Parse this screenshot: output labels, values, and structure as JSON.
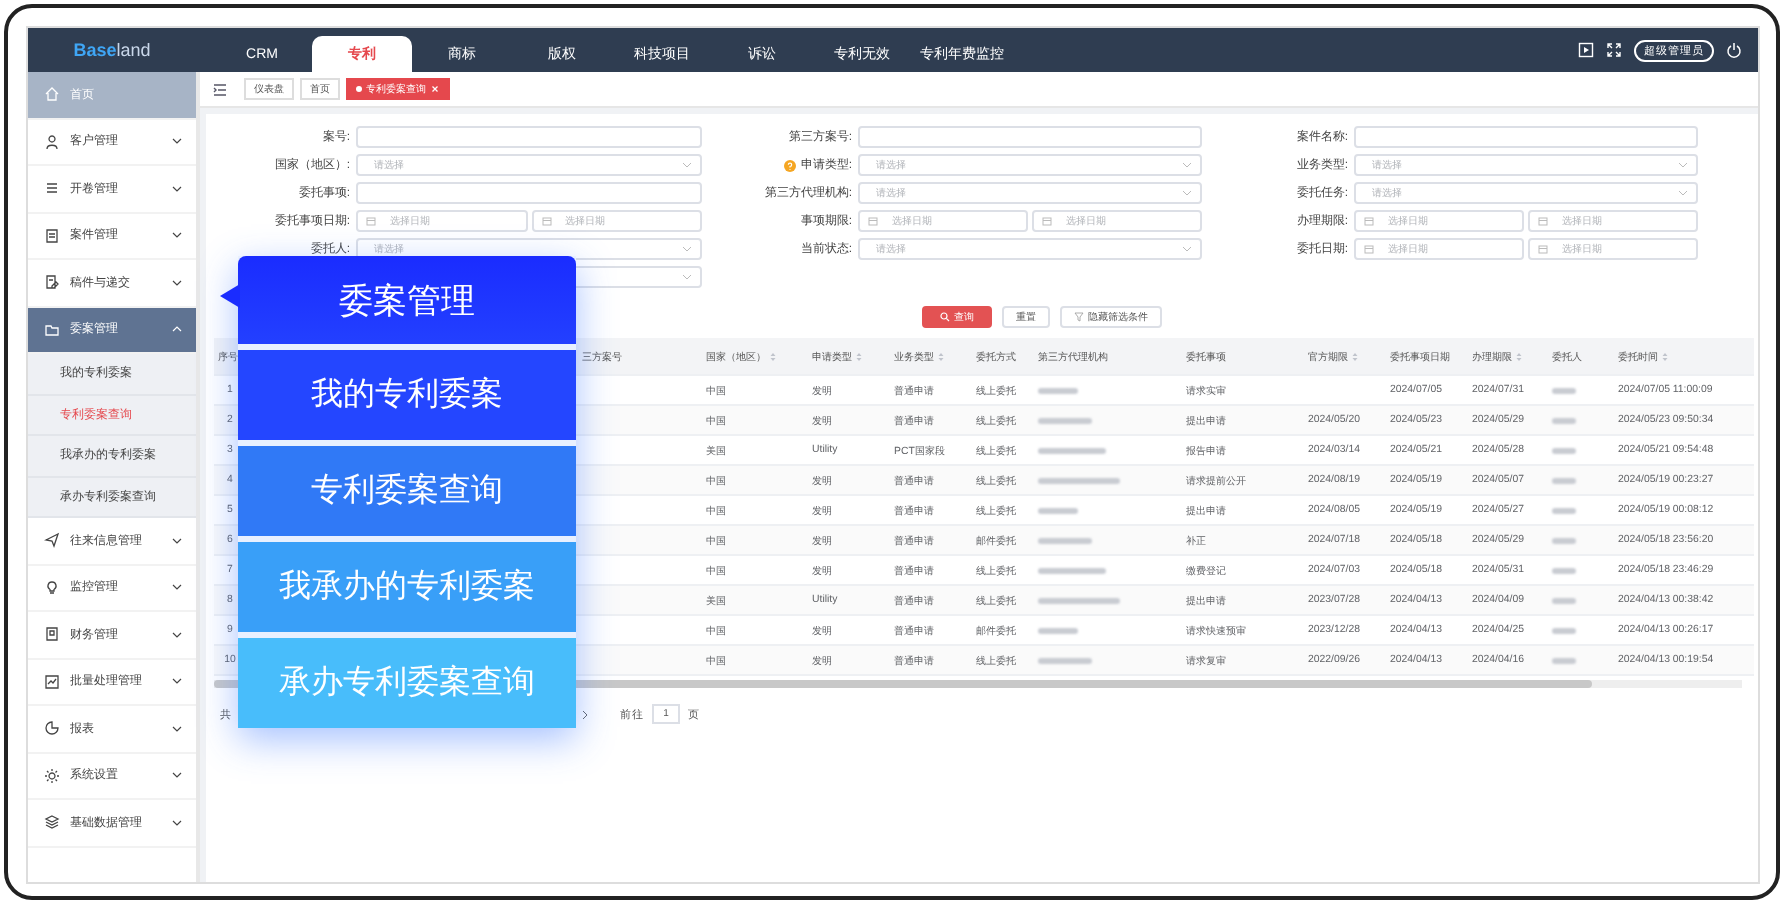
{
  "topbar": {
    "logo": {
      "part_1": "Base",
      "part_2": "land"
    },
    "tabs": [
      {
        "label": "CRM",
        "selected": false
      },
      {
        "label": "专利",
        "selected": true
      },
      {
        "label": "商标",
        "selected": false
      },
      {
        "label": "版权",
        "selected": false
      },
      {
        "label": "科技项目",
        "selected": false
      },
      {
        "label": "诉讼",
        "selected": false
      },
      {
        "label": "专利无效",
        "selected": false
      },
      {
        "label": "专利年费监控",
        "selected": false
      }
    ],
    "user": "超级管理员"
  },
  "tags_bar": {
    "tags": [
      {
        "label": "仪表盘",
        "selected": false,
        "closable": false
      },
      {
        "label": "首页",
        "selected": false,
        "closable": false
      },
      {
        "label": "专利委案查询",
        "selected": true,
        "closable": true
      }
    ]
  },
  "sidebar": {
    "items": [
      {
        "label": "首页",
        "selected": true
      },
      {
        "label": "客户管理",
        "selected": false,
        "expanded": false
      },
      {
        "label": "开卷管理",
        "selected": false,
        "expanded": false
      },
      {
        "label": "案件管理",
        "selected": false,
        "expanded": false
      },
      {
        "label": "稿件与递交",
        "selected": false,
        "expanded": false
      },
      {
        "label": "委案管理",
        "selected": false,
        "expanded": true,
        "children": [
          {
            "label": "我的专利委案",
            "selected": false
          },
          {
            "label": "专利委案查询",
            "selected": true
          },
          {
            "label": "我承办的专利委案",
            "selected": false
          },
          {
            "label": "承办专利委案查询",
            "selected": false
          }
        ]
      },
      {
        "label": "往来信息管理",
        "selected": false,
        "expanded": false
      },
      {
        "label": "监控管理",
        "selected": false,
        "expanded": false
      },
      {
        "label": "财务管理",
        "selected": false,
        "expanded": false
      },
      {
        "label": "批量处理管理",
        "selected": false,
        "expanded": false
      },
      {
        "label": "报表",
        "selected": false,
        "expanded": false
      },
      {
        "label": "系统设置",
        "selected": false,
        "expanded": false
      },
      {
        "label": "基础数据管理",
        "selected": false,
        "expanded": false
      }
    ]
  },
  "filters": [
    {
      "label": "案号:",
      "kind": "text"
    },
    {
      "label": "第三方案号:",
      "kind": "text"
    },
    {
      "label": "案件名称:",
      "kind": "text"
    },
    {
      "label": "国家（地区）:",
      "kind": "select",
      "placeholder": "请选择"
    },
    {
      "label": "申请类型:",
      "kind": "select",
      "placeholder": "请选择",
      "hint": true
    },
    {
      "label": "业务类型:",
      "kind": "select",
      "placeholder": "请选择"
    },
    {
      "label": "委托事项:",
      "kind": "text"
    },
    {
      "label": "第三方代理机构:",
      "kind": "select",
      "placeholder": "请选择"
    },
    {
      "label": "委托任务:",
      "kind": "select",
      "placeholder": "请选择"
    },
    {
      "label": "委托事项日期:",
      "kind": "date_range",
      "placeholders": [
        "选择日期",
        "选择日期"
      ]
    },
    {
      "label": "事项期限:",
      "kind": "date_range",
      "placeholders": [
        "选择日期",
        "选择日期"
      ]
    },
    {
      "label": "办理期限:",
      "kind": "date_range",
      "placeholders": [
        "选择日期",
        "选择日期"
      ]
    },
    {
      "label": "委托人:",
      "kind": "select",
      "placeholder": "请选择"
    },
    {
      "label": "当前状态:",
      "kind": "select",
      "placeholder": "请选择"
    },
    {
      "label": "委托日期:",
      "kind": "date_range",
      "placeholders": [
        "选择日期",
        "选择日期"
      ]
    },
    {
      "kind": "select"
    }
  ],
  "buttons": [
    {
      "label": "查询",
      "kind": "primary"
    },
    {
      "label": "重置",
      "kind": "default"
    },
    {
      "label": "隐藏筛选条件",
      "kind": "filter"
    }
  ],
  "table": {
    "columns": [
      {
        "label": "序号"
      },
      {
        "label": "三方案号"
      },
      {
        "label": "国家（地区）",
        "sortable": true
      },
      {
        "label": "申请类型",
        "sortable": true
      },
      {
        "label": "业务类型",
        "sortable": true
      },
      {
        "label": "委托方式"
      },
      {
        "label": "第三方代理机构",
        "blurred": true
      },
      {
        "label": "委托事项"
      },
      {
        "label": "官方期限",
        "sortable": true
      },
      {
        "label": "委托事项日期"
      },
      {
        "label": "办理期限",
        "sortable": true
      },
      {
        "label": "委托人",
        "blurred": true
      },
      {
        "label": "委托时间",
        "sortable": true
      }
    ],
    "rows": [
      {
        "cells": [
          "1",
          null,
          "中国",
          "发明",
          "普通申请",
          "线上委托",
          null,
          "请求实审",
          null,
          "2024/07/05",
          "2024/07/31",
          null,
          "2024/07/05 11:00:09"
        ]
      },
      {
        "cells": [
          "2",
          null,
          "中国",
          "发明",
          "普通申请",
          "线上委托",
          null,
          "提出申请",
          "2024/05/20",
          "2024/05/23",
          "2024/05/29",
          null,
          "2024/05/23 09:50:34"
        ]
      },
      {
        "cells": [
          "3",
          null,
          "美国",
          "Utility",
          "PCT国家段",
          "线上委托",
          null,
          "报告申请",
          "2024/03/14",
          "2024/05/21",
          "2024/05/28",
          null,
          "2024/05/21 09:54:48"
        ]
      },
      {
        "cells": [
          "4",
          null,
          "中国",
          "发明",
          "普通申请",
          "线上委托",
          null,
          "请求提前公开",
          "2024/08/19",
          "2024/05/19",
          "2024/05/07",
          null,
          "2024/05/19 00:23:27"
        ]
      },
      {
        "cells": [
          "5",
          null,
          "中国",
          "发明",
          "普通申请",
          "线上委托",
          null,
          "提出申请",
          "2024/08/05",
          "2024/05/19",
          "2024/05/27",
          null,
          "2024/05/19 00:08:12"
        ]
      },
      {
        "cells": [
          "6",
          null,
          "中国",
          "发明",
          "普通申请",
          "邮件委托",
          null,
          "补正",
          "2024/07/18",
          "2024/05/18",
          "2024/05/29",
          null,
          "2024/05/18 23:56:20"
        ]
      },
      {
        "cells": [
          "7",
          null,
          "中国",
          "发明",
          "普通申请",
          "线上委托",
          null,
          "缴费登记",
          "2024/07/03",
          "2024/05/18",
          "2024/05/31",
          null,
          "2024/05/18 23:46:29"
        ]
      },
      {
        "cells": [
          "8",
          null,
          "美国",
          "Utility",
          "普通申请",
          "线上委托",
          null,
          "提出申请",
          "2023/07/28",
          "2024/04/13",
          "2024/04/09",
          null,
          "2024/04/13 00:38:42"
        ]
      },
      {
        "cells": [
          "9",
          null,
          "中国",
          "发明",
          "普通申请",
          "邮件委托",
          null,
          "请求快速预审",
          "2023/12/28",
          "2024/04/13",
          "2024/04/25",
          null,
          "2024/04/13 00:26:17"
        ]
      },
      {
        "cells": [
          "10",
          null,
          "中国",
          "发明",
          "普通申请",
          "线上委托",
          null,
          "请求复审",
          "2022/09/26",
          "2024/04/13",
          "2024/04/16",
          null,
          "2024/04/13 00:19:54"
        ]
      }
    ]
  },
  "pagination": {
    "total": "共",
    "goto_label": "前往",
    "page": "1",
    "page_suffix": "页"
  },
  "callout": {
    "title": "委案管理",
    "items": [
      "我的专利委案",
      "专利委案查询",
      "我承办的专利委案",
      "承办专利委案查询"
    ]
  }
}
